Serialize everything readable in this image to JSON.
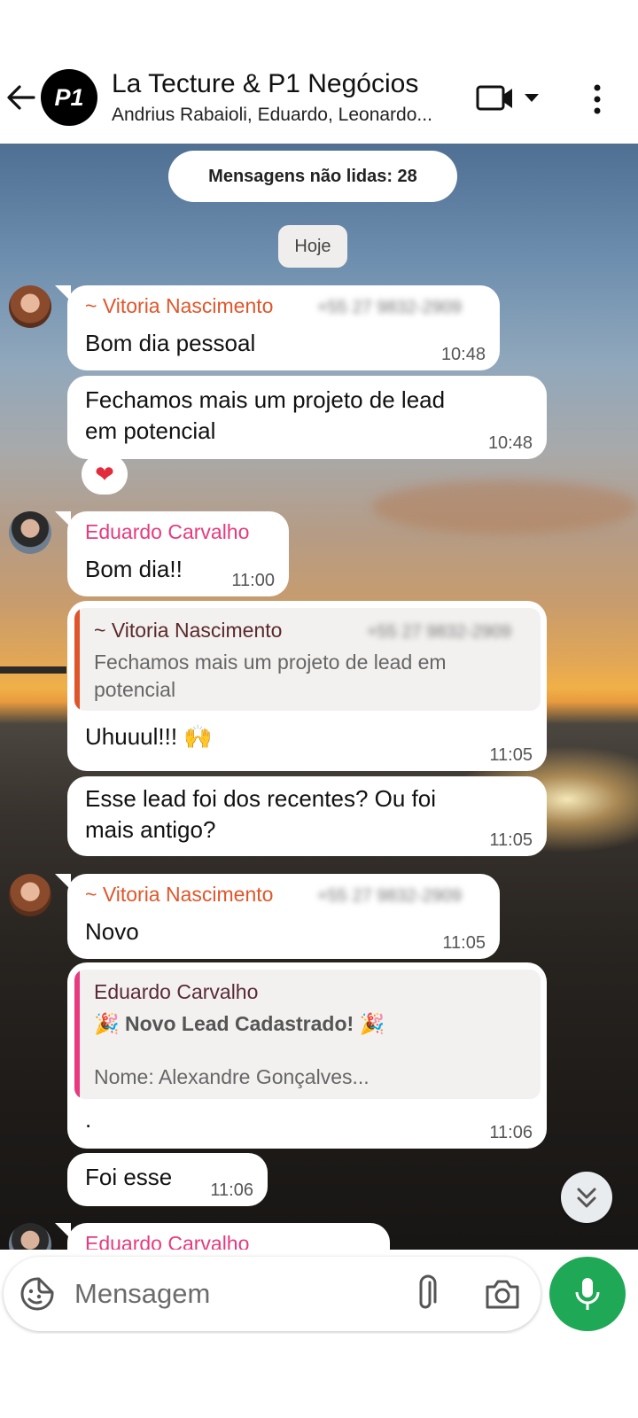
{
  "header": {
    "title": "La Tecture & P1 Negócios",
    "subtitle": "Andrius Rabaioli, Eduardo, Leonardo...",
    "avatar_text": "P1"
  },
  "banners": {
    "unread": "Mensagens não lidas: 28",
    "date": "Hoje"
  },
  "messages": [
    {
      "sender": "~ Vitoria Nascimento",
      "phone": "+55 27 9832-2909",
      "text": "Bom dia pessoal",
      "time": "10:48"
    },
    {
      "text_lines": [
        "Fechamos mais um projeto de lead",
        "em potencial"
      ],
      "time": "10:48",
      "reaction": "❤"
    },
    {
      "sender": "Eduardo Carvalho",
      "text": "Bom dia!!",
      "time": "11:00"
    },
    {
      "quote": {
        "sender": "~ Vitoria Nascimento",
        "phone": "+55 27 9832-2909",
        "lines": [
          "Fechamos mais um projeto de lead em",
          "potencial"
        ]
      },
      "text": "Uhuuul!!! 🙌",
      "time": "11:05"
    },
    {
      "text_lines": [
        "Esse lead foi dos recentes? Ou foi",
        "mais antigo?"
      ],
      "time": "11:05"
    },
    {
      "sender": "~ Vitoria Nascimento",
      "phone": "+55 27 9832-2909",
      "text": "Novo",
      "time": "11:05"
    },
    {
      "quote": {
        "sender": "Eduardo Carvalho",
        "title": "🎉 Novo Lead Cadastrado! 🎉",
        "line": "Nome: Alexandre Gonçalves..."
      },
      "text": ".",
      "time": "11:06"
    },
    {
      "text": "Foi esse",
      "time": "11:06"
    },
    {
      "sender": "Eduardo Carvalho"
    }
  ],
  "composer": {
    "placeholder": "Mensagem"
  },
  "icons": {
    "back": "arrow-left-icon",
    "video": "video-camera-icon",
    "menu": "more-vertical-icon",
    "sticker": "sticker-icon",
    "attach": "paperclip-icon",
    "camera": "camera-icon",
    "mic": "microphone-icon",
    "scroll": "chevron-double-down-icon"
  },
  "colors": {
    "accent_green": "#1fa855",
    "sender_orange": "#e0562b",
    "sender_pink": "#e83a7e"
  }
}
